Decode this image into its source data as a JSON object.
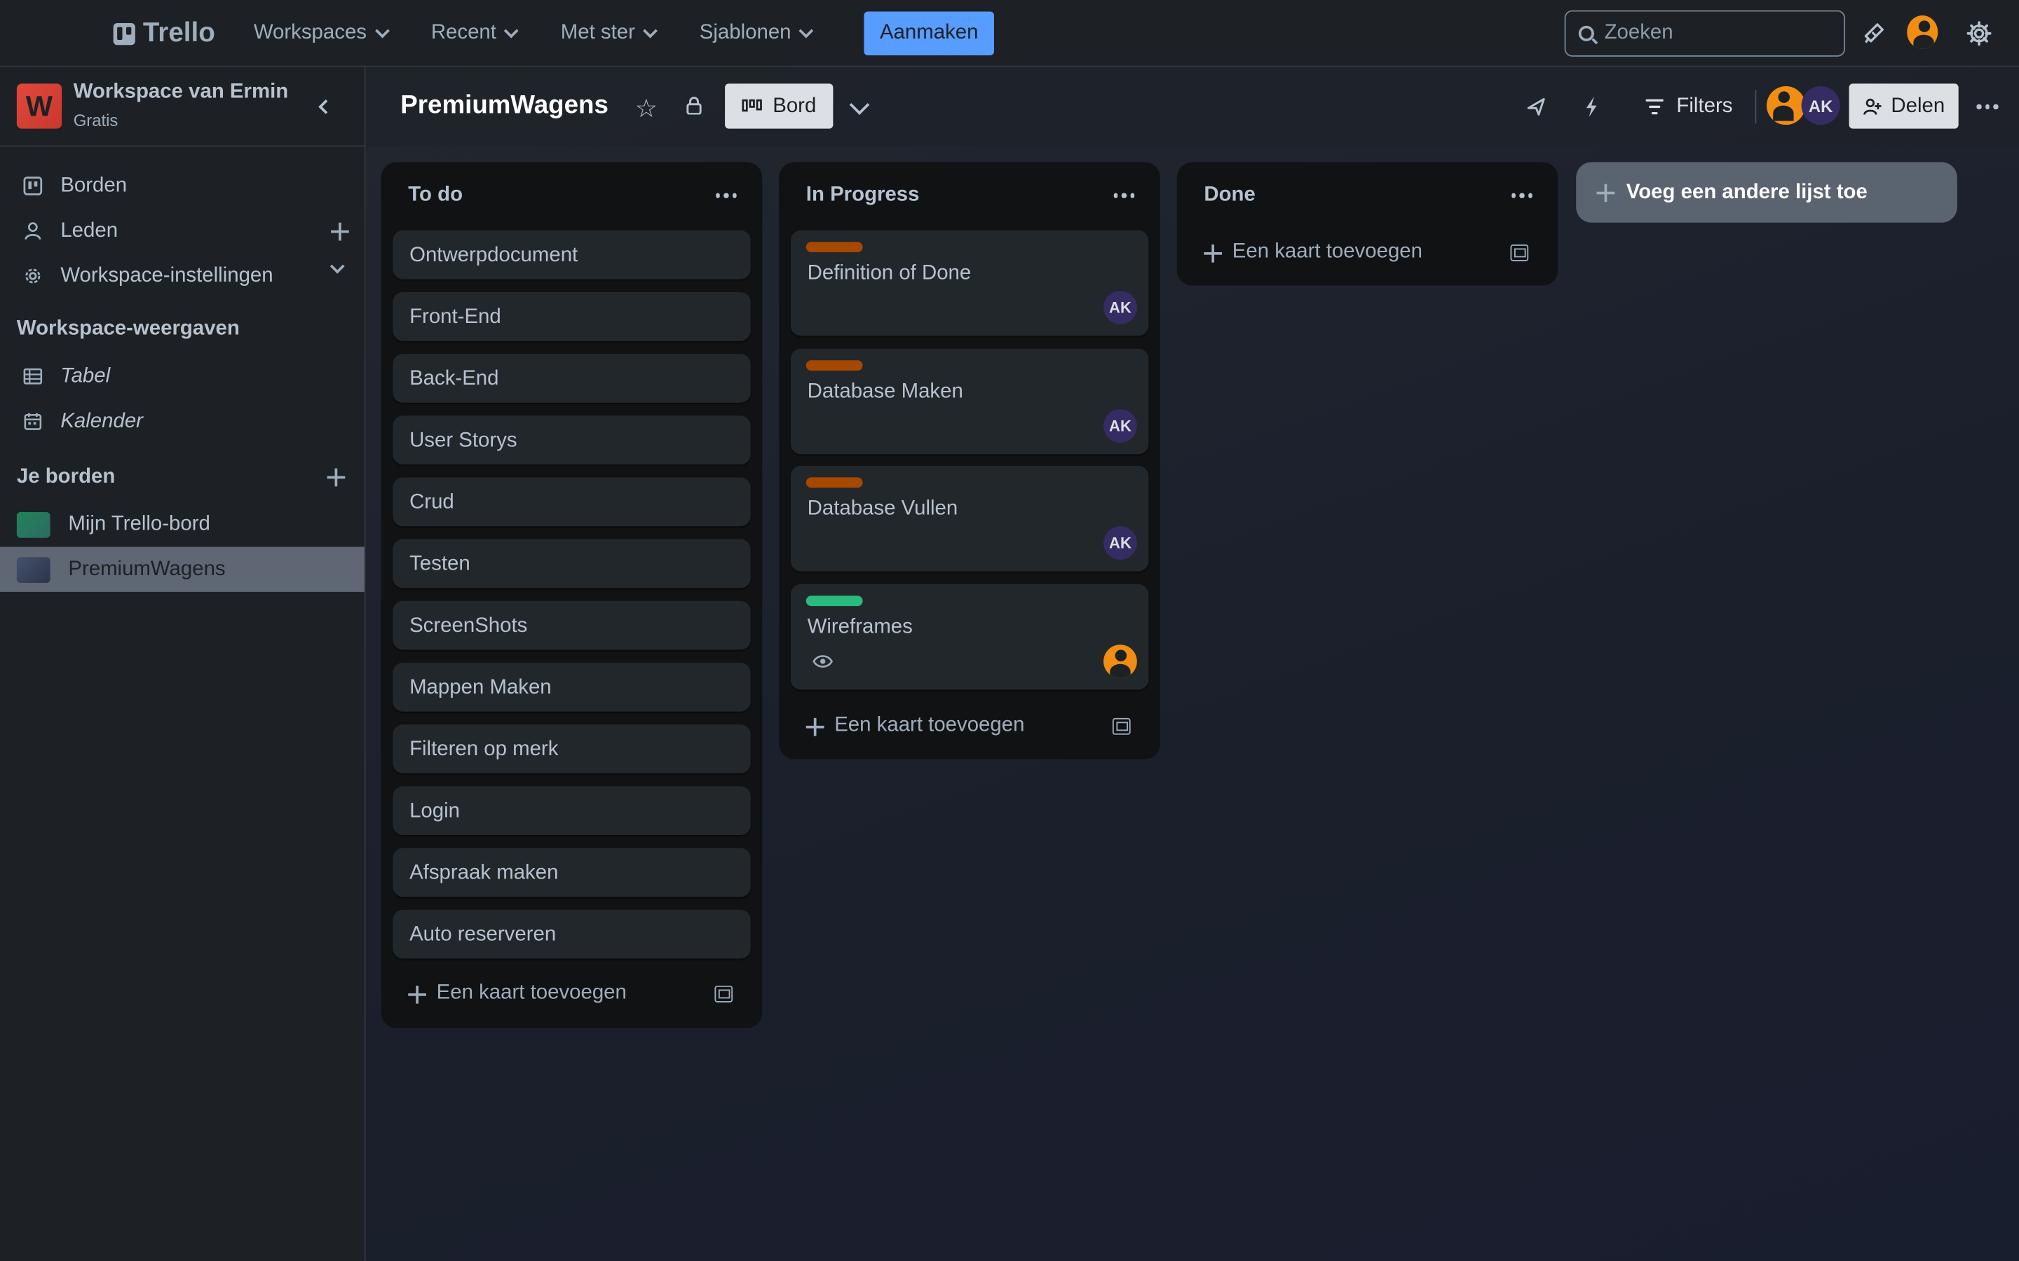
{
  "topbar": {
    "logo_text": "Trello",
    "nav": [
      {
        "label": "Workspaces"
      },
      {
        "label": "Recent"
      },
      {
        "label": "Met ster"
      },
      {
        "label": "Sjablonen"
      }
    ],
    "create_label": "Aanmaken",
    "search_placeholder": "Zoeken",
    "icons": [
      "megaphone-icon",
      "account-avatar",
      "gear-icon"
    ]
  },
  "sidebar": {
    "workspace_initial": "W",
    "workspace_name": "Workspace van Ermin",
    "workspace_plan": "Gratis",
    "items": [
      {
        "label": "Borden",
        "icon": "board-icon"
      },
      {
        "label": "Leden",
        "icon": "person-icon"
      },
      {
        "label": "Workspace-instellingen",
        "icon": "gear-icon"
      }
    ],
    "views_heading": "Workspace-weergaven",
    "views": [
      {
        "label": "Tabel",
        "icon": "table-icon"
      },
      {
        "label": "Kalender",
        "icon": "calendar-icon"
      }
    ],
    "boards_heading": "Je borden",
    "boards": [
      {
        "label": "Mijn Trello-bord",
        "color": "#1f845a"
      },
      {
        "label": "PremiumWagens",
        "color": "#3d4a66",
        "active": true
      }
    ]
  },
  "board": {
    "title": "PremiumWagens",
    "view_label": "Bord",
    "filters_label": "Filters",
    "share_label": "Delen",
    "member_initials": "AK"
  },
  "lists": [
    {
      "title": "To do",
      "cards": [
        {
          "title": "Ontwerpdocument"
        },
        {
          "title": "Front-End"
        },
        {
          "title": "Back-End"
        },
        {
          "title": "User Storys"
        },
        {
          "title": "Crud"
        },
        {
          "title": "Testen"
        },
        {
          "title": "ScreenShots"
        },
        {
          "title": "Mappen Maken"
        },
        {
          "title": "Filteren op merk"
        },
        {
          "title": "Login"
        },
        {
          "title": "Afspraak maken"
        },
        {
          "title": "Auto reserveren"
        }
      ],
      "add_label": "Een kaart toevoegen"
    },
    {
      "title": "In Progress",
      "cards": [
        {
          "title": "Definition of Done",
          "label_color": "#a54800",
          "member": "AK"
        },
        {
          "title": "Database Maken",
          "label_color": "#a54800",
          "member": "AK"
        },
        {
          "title": "Database Vullen",
          "label_color": "#a54800",
          "member": "AK"
        },
        {
          "title": "Wireframes",
          "label_color": "#2abb7f",
          "member": "avatar-orange",
          "badge": "eye-icon"
        }
      ],
      "add_label": "Een kaart toevoegen"
    },
    {
      "title": "Done",
      "cards": [],
      "add_label": "Een kaart toevoegen"
    }
  ],
  "add_list_label": "Voeg een andere lijst toe"
}
